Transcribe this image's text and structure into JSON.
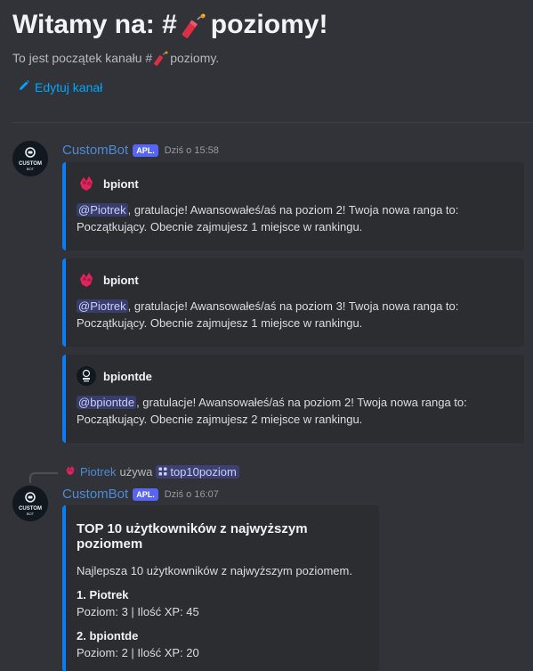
{
  "welcome": {
    "title_prefix": "Witamy na: #",
    "title_suffix": "poziomy!",
    "subtitle_prefix": "To jest początek kanału #",
    "subtitle_suffix": "poziomy.",
    "edit_label": "Edytuj kanał"
  },
  "messages": [
    {
      "author": "CustomBot",
      "badge": "APL.",
      "timestamp": "Dziś o 15:58",
      "embeds": [
        {
          "author_name": "bpiont",
          "mention": "@Piotrek",
          "text": ", gratulacje! Awansowałeś/aś na poziom 2! Twoja nowa ranga to: Początkujący. Obecnie zajmujesz 1 miejsce w rankingu."
        },
        {
          "author_name": "bpiont",
          "mention": "@Piotrek",
          "text": ", gratulacje! Awansowałeś/aś na poziom 3! Twoja nowa ranga to: Początkujący. Obecnie zajmujesz 1 miejsce w rankingu."
        },
        {
          "author_name": "bpiontde",
          "mention": "@bpiontde",
          "text": ", gratulacje! Awansowałeś/aś na poziom 2! Twoja nowa ranga to: Początkujący. Obecnie zajmujesz 2 miejsce w rankingu."
        }
      ]
    },
    {
      "reply_user": "Piotrek",
      "reply_uses": "używa",
      "reply_command": "top10poziom",
      "author": "CustomBot",
      "badge": "APL.",
      "timestamp": "Dziś o 16:07",
      "embed": {
        "title": "TOP 10 użytkowników z najwyższym poziomem",
        "description": "Najlepsza 10 użytkowników z najwyższym poziomem.",
        "fields": [
          {
            "name": "1. Piotrek",
            "value": "Poziom: 3 | Ilość XP: 45"
          },
          {
            "name": "2. bpiontde",
            "value": "Poziom: 2 | Ilość XP: 20"
          }
        ]
      }
    }
  ],
  "avatar_text": {
    "line1": "CUSTOM",
    "line2": "BOT"
  },
  "colors": {
    "accent": "#0a7cf5",
    "link": "#00a8fc",
    "author": "#4d8bd4",
    "badge": "#5865f2"
  },
  "icons": {
    "channel": "firecracker-icon",
    "edit": "pencil-icon",
    "command": "slash-command-icon"
  }
}
